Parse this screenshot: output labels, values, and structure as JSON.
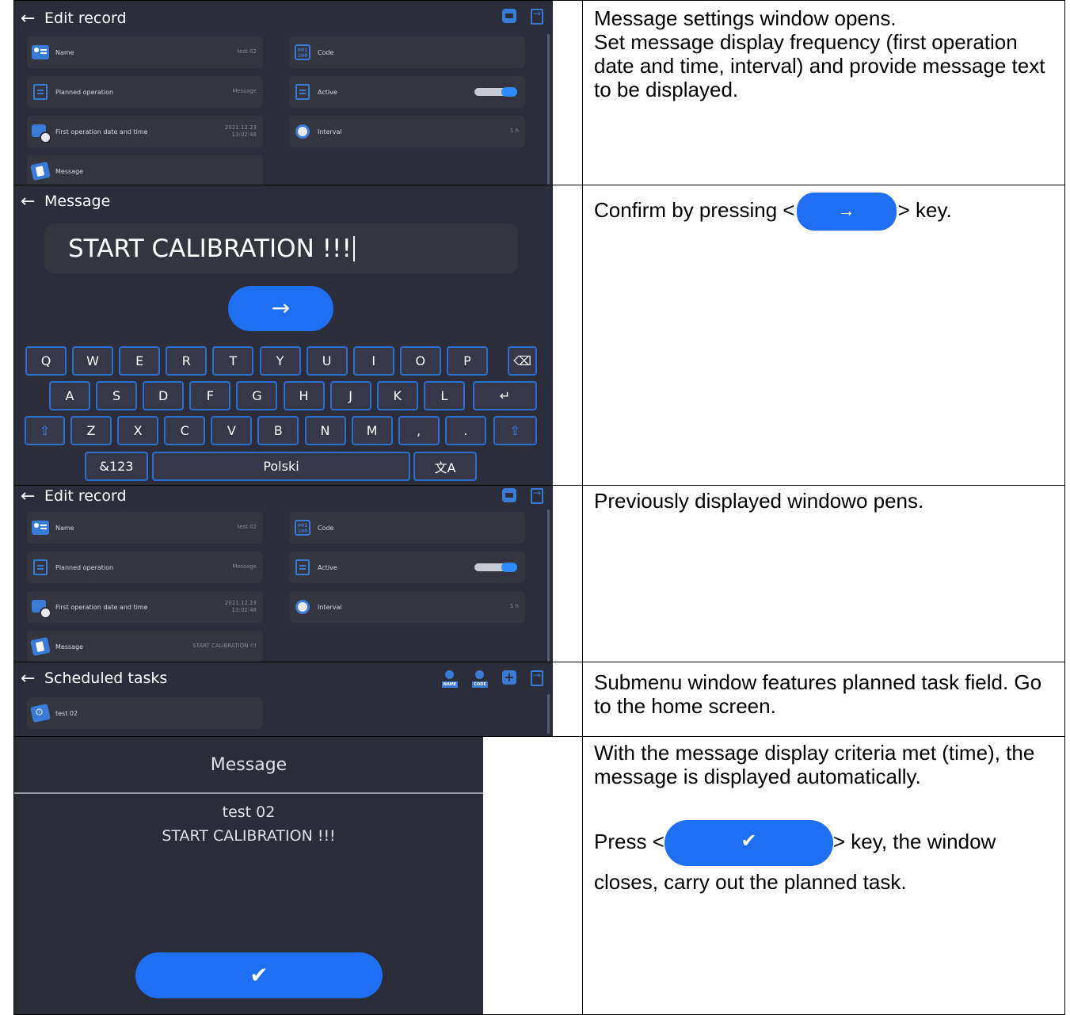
{
  "rows": [
    {
      "panel": {
        "title": "Edit record",
        "fields": {
          "name_label": "Name",
          "name_value": "test 02",
          "code_label": "Code",
          "code_badge_top": "001",
          "code_badge_bottom": "100",
          "planned_label": "Planned operation",
          "planned_value": "Message",
          "active_label": "Active",
          "active_on": true,
          "first_label": "First operation date and time",
          "first_date": "2021.12.23",
          "first_time": "13:02:48",
          "interval_label": "Interval",
          "interval_value": "1 h",
          "message_label": "Message",
          "message_value": ""
        }
      },
      "text": "Message settings window opens.\nSet message display frequency (first operation date and time, interval) and provide message text to be displayed."
    },
    {
      "panel": {
        "title": "Message",
        "input_value": "START CALIBRATION !!!",
        "go_arrow": "→",
        "keys_row1": [
          "Q",
          "W",
          "E",
          "R",
          "T",
          "Y",
          "U",
          "I",
          "O",
          "P"
        ],
        "keys_row2": [
          "A",
          "S",
          "D",
          "F",
          "G",
          "H",
          "J",
          "K",
          "L"
        ],
        "keys_row3": [
          "Z",
          "X",
          "C",
          "V",
          "B",
          "N",
          "M",
          ",",
          "."
        ],
        "backspace": "⌫",
        "enter": "↵",
        "shift": "⇧",
        "num_key": "&123",
        "space_key": "Polski",
        "lang_key": "文A"
      },
      "text_before": "Confirm by pressing <",
      "text_btn": "→",
      "text_after": "> key."
    },
    {
      "panel": {
        "title": "Edit record",
        "fields": {
          "name_label": "Name",
          "name_value": "test 02",
          "code_label": "Code",
          "code_badge_top": "001",
          "code_badge_bottom": "100",
          "planned_label": "Planned operation",
          "planned_value": "Message",
          "active_label": "Active",
          "active_on": true,
          "first_label": "First operation date and time",
          "first_date": "2021.12.23",
          "first_time": "13:02:48",
          "interval_label": "Interval",
          "interval_value": "1 h",
          "message_label": "Message",
          "message_value": "START CALIBRATION !!!"
        }
      },
      "text": "Previously displayed windowo pens."
    },
    {
      "panel": {
        "title": "Scheduled tasks",
        "search_name_tag": "NAME",
        "search_code_tag": "CODE",
        "item": "test 02"
      },
      "text": "Submenu window features planned task field. Go to the home screen."
    },
    {
      "panel": {
        "title": "Message",
        "line1": "test 02",
        "line2": "START CALIBRATION !!!",
        "ok_glyph": "✔"
      },
      "text1": "With the message display criteria met (time), the message is displayed automatically.",
      "text2_before": "Press <",
      "text2_btn": "✔",
      "text2_after": "> key, the window closes, carry out the planned task."
    }
  ],
  "colors": {
    "panel_bg": "#2b2d3a",
    "tile_bg": "#33353f",
    "accent": "#1e6ff2",
    "icon_blue": "#3a7bd5"
  }
}
